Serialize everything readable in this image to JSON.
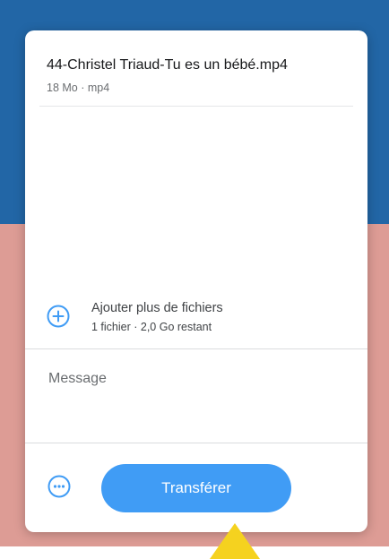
{
  "file": {
    "name": "44-Christel Triaud-Tu es un bébé.mp4",
    "meta": "18 Mo · mp4"
  },
  "add_files": {
    "label": "Ajouter plus de fichiers",
    "meta": "1 fichier · 2,0 Go restant",
    "icon": "plus-circle-icon"
  },
  "message": {
    "placeholder": "Message"
  },
  "actions": {
    "more_icon": "ellipsis-circle-icon",
    "transfer_label": "Transférer"
  },
  "colors": {
    "background_top": "#2266a6",
    "background_bottom": "#dd9c95",
    "accent": "#409cf5",
    "cursor_arrow": "#f5d21f"
  }
}
